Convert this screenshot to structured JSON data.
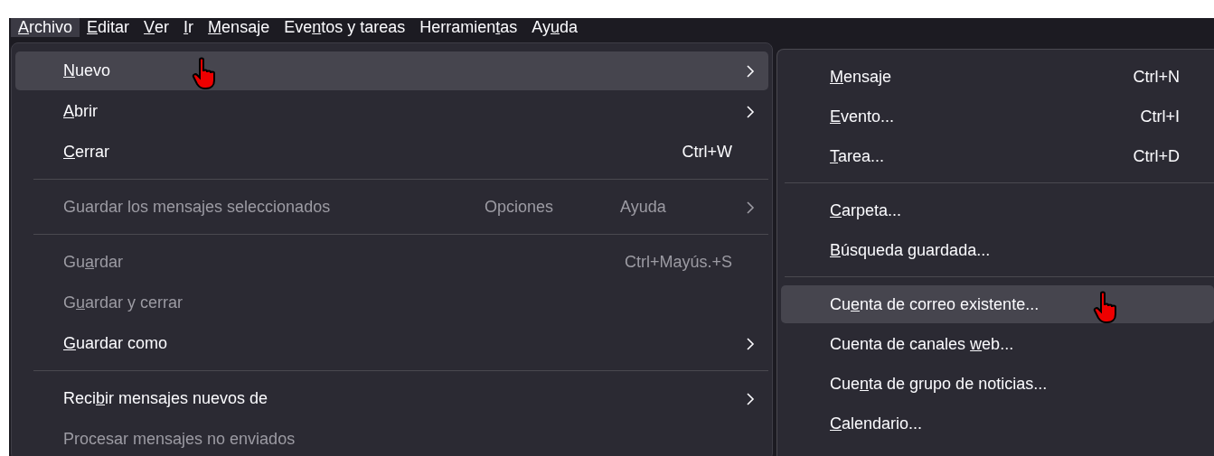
{
  "menubar": [
    {
      "label": {
        "key": "A",
        "after": "rchivo"
      },
      "selected": true
    },
    {
      "label": {
        "key": "E",
        "after": "ditar"
      },
      "selected": false
    },
    {
      "label": {
        "key": "V",
        "after": "er"
      },
      "selected": false
    },
    {
      "label": {
        "key": "I",
        "after": "r"
      },
      "selected": false
    },
    {
      "label": {
        "key": "M",
        "after": "ensaje"
      },
      "selected": false
    },
    {
      "label": {
        "before": "Eve",
        "key": "n",
        "after": "tos y tareas"
      },
      "selected": false
    },
    {
      "label": {
        "before": "Herramien",
        "key": "t",
        "after": "as"
      },
      "selected": false
    },
    {
      "label": {
        "before": "Ay",
        "key": "u",
        "after": "da"
      },
      "selected": false
    }
  ],
  "file_menu": [
    {
      "kind": "item",
      "label": {
        "key": "N",
        "after": "uevo"
      },
      "submenu": true,
      "disabled": false,
      "selected": true
    },
    {
      "kind": "item",
      "label": {
        "key": "A",
        "after": "brir"
      },
      "submenu": true,
      "disabled": false,
      "selected": false
    },
    {
      "kind": "item",
      "label": {
        "key": "C",
        "after": "errar"
      },
      "shortcut": "Ctrl+W",
      "submenu": false,
      "disabled": false,
      "selected": false
    },
    {
      "kind": "separator"
    },
    {
      "kind": "item",
      "label": {
        "before": "Guardar los mensajes seleccionados"
      },
      "extras": [
        "Opciones",
        "Ayuda"
      ],
      "submenu": true,
      "disabled": true,
      "selected": false
    },
    {
      "kind": "separator"
    },
    {
      "kind": "item",
      "label": {
        "before": "Gu",
        "key": "a",
        "after": "rdar"
      },
      "shortcut": "Ctrl+Mayús.+S",
      "submenu": false,
      "disabled": true,
      "selected": false
    },
    {
      "kind": "item",
      "label": {
        "before": "G",
        "key": "u",
        "after": "ardar y cerrar"
      },
      "submenu": false,
      "disabled": true,
      "selected": false
    },
    {
      "kind": "item",
      "label": {
        "key": "G",
        "after": "uardar como"
      },
      "submenu": true,
      "disabled": false,
      "selected": false
    },
    {
      "kind": "separator"
    },
    {
      "kind": "item",
      "label": {
        "before": "Reci",
        "key": "b",
        "after": "ir mensajes nuevos de"
      },
      "submenu": true,
      "disabled": false,
      "selected": false
    },
    {
      "kind": "item",
      "label": {
        "before": "Procesar mensajes no enviados"
      },
      "submenu": false,
      "disabled": true,
      "selected": false
    }
  ],
  "new_submenu": [
    {
      "kind": "item",
      "label": {
        "key": "M",
        "after": "ensaje"
      },
      "shortcut": "Ctrl+N",
      "selected": false
    },
    {
      "kind": "item",
      "label": {
        "key": "E",
        "after": "vento..."
      },
      "shortcut": "Ctrl+I",
      "selected": false
    },
    {
      "kind": "item",
      "label": {
        "key": "T",
        "after": "area..."
      },
      "shortcut": "Ctrl+D",
      "selected": false
    },
    {
      "kind": "separator"
    },
    {
      "kind": "item",
      "label": {
        "key": "C",
        "after": "arpeta..."
      },
      "selected": false
    },
    {
      "kind": "item",
      "label": {
        "key": "B",
        "after": "úsqueda guardada..."
      },
      "selected": false
    },
    {
      "kind": "separator"
    },
    {
      "kind": "item",
      "label": {
        "before": "Cu",
        "key": "e",
        "after": "nta de correo existente..."
      },
      "selected": true
    },
    {
      "kind": "item",
      "label": {
        "before": "Cuenta de canales ",
        "key": "w",
        "after": "eb..."
      },
      "selected": false
    },
    {
      "kind": "item",
      "label": {
        "before": "Cue",
        "key": "n",
        "after": "ta de grupo de noticias..."
      },
      "selected": false
    },
    {
      "kind": "item",
      "label": {
        "key": "C",
        "after": "alendario..."
      },
      "selected": false
    }
  ]
}
